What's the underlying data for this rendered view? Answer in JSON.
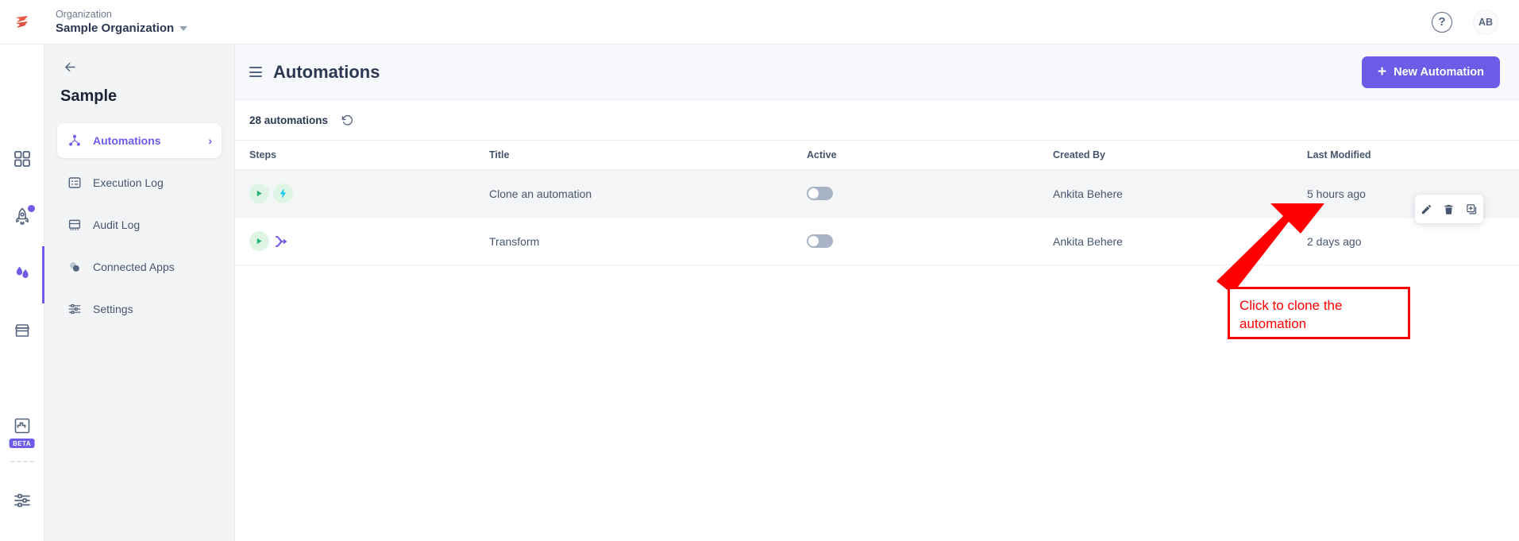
{
  "topbar": {
    "logo_icon": "brand-logo-icon",
    "org_label": "Organization",
    "org_name": "Sample Organization",
    "caret_icon": "chevron-down-icon",
    "help_icon": "help-icon",
    "help_glyph": "?",
    "avatar_initials": "AB"
  },
  "rail": {
    "items": [
      {
        "icon": "grid-dashboard-icon",
        "active": false,
        "dot": false,
        "beta": false
      },
      {
        "icon": "rocket-icon",
        "active": false,
        "dot": true,
        "beta": false
      },
      {
        "icon": "droplets-icon",
        "active": true,
        "dot": false,
        "beta": false
      },
      {
        "icon": "storefront-icon",
        "active": false,
        "dot": false,
        "beta": false
      },
      {
        "icon": "flow-puzzle-icon",
        "active": false,
        "dot": false,
        "beta": true,
        "beta_label": "BETA"
      },
      {
        "icon": "sliders-settings-icon",
        "active": false,
        "dot": false,
        "beta": false
      }
    ]
  },
  "panel": {
    "back_icon": "back-arrow-icon",
    "title": "Sample",
    "items": [
      {
        "label": "Automations",
        "icon": "automations-node-icon",
        "active": true,
        "chevron": "›"
      },
      {
        "label": "Execution Log",
        "icon": "execution-log-icon",
        "active": false
      },
      {
        "label": "Audit Log",
        "icon": "audit-log-icon",
        "active": false
      },
      {
        "label": "Connected Apps",
        "icon": "connected-apps-icon",
        "active": false
      },
      {
        "label": "Settings",
        "icon": "settings-sliders-icon",
        "active": false
      }
    ]
  },
  "main": {
    "menu_icon": "hamburger-menu-icon",
    "title": "Automations",
    "new_button_label": "New Automation",
    "new_button_plus": "+",
    "count_text": "28 automations",
    "refresh_icon": "refresh-icon",
    "columns": [
      "Steps",
      "Title",
      "Active",
      "Created By",
      "Last Modified"
    ],
    "rows": [
      {
        "step_icons": [
          "play-icon",
          "lightning-bolt-icon"
        ],
        "title": "Clone an automation",
        "active": false,
        "created_by": "Ankita Behere",
        "last_modified": "5 hours ago",
        "hovered": true
      },
      {
        "step_icons": [
          "play-icon",
          "branch-split-icon"
        ],
        "title": "Transform",
        "active": false,
        "created_by": "Ankita Behere",
        "last_modified": "2 days ago",
        "hovered": false
      }
    ],
    "row_actions": [
      {
        "icon": "edit-pencil-icon",
        "name": "edit"
      },
      {
        "icon": "delete-trash-icon",
        "name": "delete"
      },
      {
        "icon": "clone-copy-icon",
        "name": "clone"
      }
    ]
  },
  "annotation": {
    "text": "Click to clone the automation",
    "color": "#ff0000",
    "arrow_icon": "pointer-arrow-icon"
  },
  "colors": {
    "accent": "#6c5ce7",
    "text_dark": "#2c3852",
    "text_muted": "#46556e",
    "panel_bg": "#f3f4f6",
    "header_bg": "#f8f9fc",
    "row_alt_bg": "#f4f5f7",
    "step_circle_bg": "#def5e6",
    "play_green": "#2bb673",
    "bolt_cyan": "#12c8ec",
    "branch_purple": "#6c5ce7",
    "toggle_off": "#a8b3c5",
    "annotation_red": "#ff0000"
  }
}
